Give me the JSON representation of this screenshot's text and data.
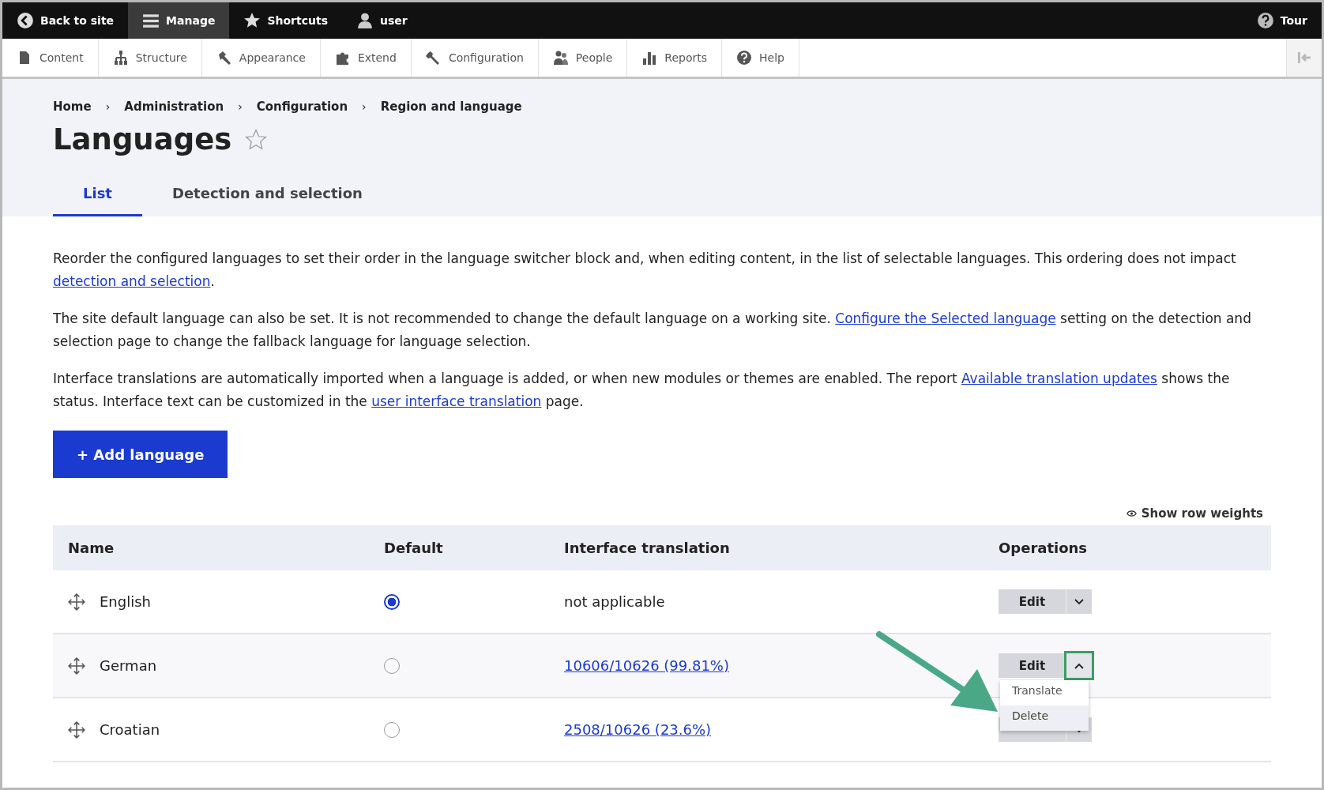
{
  "toolbar": {
    "items": [
      {
        "label": "Back to site",
        "selected": false
      },
      {
        "label": "Manage",
        "selected": true
      },
      {
        "label": "Shortcuts",
        "selected": false
      },
      {
        "label": "user",
        "selected": false
      }
    ],
    "tour": "Tour"
  },
  "admin_menu": [
    "Content",
    "Structure",
    "Appearance",
    "Extend",
    "Configuration",
    "People",
    "Reports",
    "Help"
  ],
  "breadcrumb": [
    "Home",
    "Administration",
    "Configuration",
    "Region and language"
  ],
  "breadcrumb_separator": "›",
  "page_title": "Languages",
  "tabs": [
    {
      "label": "List",
      "selected": true
    },
    {
      "label": "Detection and selection",
      "selected": false
    }
  ],
  "paragraphs": [
    [
      {
        "kind": "text",
        "text": "Reorder the configured languages to set their order in the language switcher block and, when editing content, in the list of selectable languages. This ordering does not impact "
      },
      {
        "kind": "link",
        "text": "detection and selection"
      },
      {
        "kind": "text",
        "text": "."
      }
    ],
    [
      {
        "kind": "text",
        "text": "The site default language can also be set. It is not recommended to change the default language on a working site. "
      },
      {
        "kind": "link",
        "text": "Configure the Selected language"
      },
      {
        "kind": "text",
        "text": " setting on the detection and selection page to change the fallback language for language selection."
      }
    ],
    [
      {
        "kind": "text",
        "text": "Interface translations are automatically imported when a language is added, or when new modules or themes are enabled. The report "
      },
      {
        "kind": "link",
        "text": "Available translation updates"
      },
      {
        "kind": "text",
        "text": " shows the status. Interface text can be customized in the "
      },
      {
        "kind": "link",
        "text": "user interface translation"
      },
      {
        "kind": "text",
        "text": " page."
      }
    ]
  ],
  "add_button": "+ Add language",
  "show_weights": "Show row weights",
  "table": {
    "columns": [
      "Name",
      "Default",
      "Interface translation",
      "Operations"
    ],
    "rows": [
      {
        "name": "English",
        "selected": true,
        "translation": {
          "kind": "text",
          "text": "not applicable"
        },
        "edit": "Edit",
        "expanded": false
      },
      {
        "name": "German",
        "selected": false,
        "translation": {
          "kind": "link",
          "text": "10606/10626 (99.81%)"
        },
        "edit": "Edit",
        "expanded": true,
        "menu": [
          {
            "label": "Translate",
            "selected": false
          },
          {
            "label": "Delete",
            "selected": true
          }
        ]
      },
      {
        "name": "Croatian",
        "selected": false,
        "translation": {
          "kind": "link",
          "text": "2508/10626 (23.6%)"
        },
        "expanded": false
      }
    ]
  }
}
